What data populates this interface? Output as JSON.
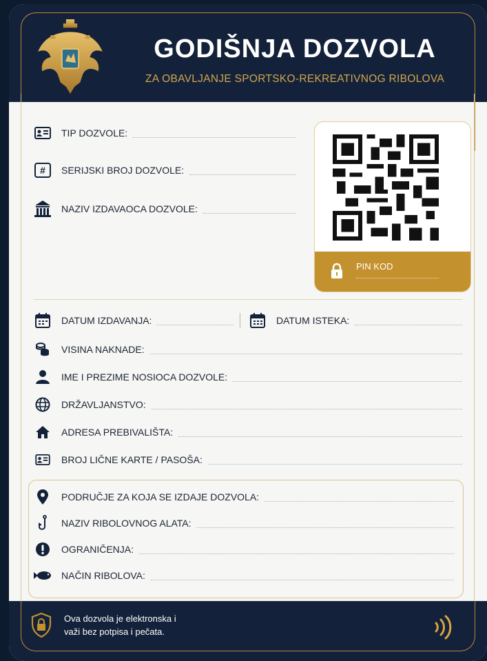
{
  "header": {
    "title": "GODIŠNJA DOZVOLA",
    "subtitle": "ZA OBAVLJANJE SPORTSKO-REKREATIVNOG RIBOLOVA",
    "crest_icon": "montenegro-coat-of-arms"
  },
  "top_fields": [
    {
      "label": "TIP DOZVOLE:",
      "icon": "id-card-icon"
    },
    {
      "label": "SERIJSKI BROJ DOZVOLE:",
      "icon": "hash-icon"
    },
    {
      "label": "NAZIV IZDAVAOCA DOZVOLE:",
      "icon": "building-icon"
    }
  ],
  "qr": {
    "pin_label": "PIN KOD"
  },
  "dates": {
    "issue_label": "DATUM IZDAVANJA:",
    "expiry_label": "DATUM ISTEKA:"
  },
  "person_fields": [
    {
      "label": "VISINA NAKNADE:",
      "icon": "coins-icon"
    },
    {
      "label": "IME I PREZIME NOSIOCA DOZVOLE:",
      "icon": "person-icon"
    },
    {
      "label": "DRŽAVLJANSTVO:",
      "icon": "globe-icon"
    },
    {
      "label": "ADRESA PREBIVALIŠTA:",
      "icon": "home-icon"
    },
    {
      "label": "BROJ LIČNE KARTE / PASOŠA:",
      "icon": "id-card-icon"
    }
  ],
  "fishing_fields": [
    {
      "label": "PODRUČJE ZA KOJA SE IZDAJE DOZVOLA:",
      "icon": "location-pin-icon"
    },
    {
      "label": "NAZIV RIBOLOVNOG ALATA:",
      "icon": "fish-hook-icon"
    },
    {
      "label": "OGRANIČENJA:",
      "icon": "warning-icon"
    },
    {
      "label": "NAČIN RIBOLOVA:",
      "icon": "fish-icon"
    }
  ],
  "footer": {
    "line1": "Ova dozvola je elektronska i",
    "line2": "važi bez potpisa i pečata.",
    "shield_icon": "shield-lock-icon",
    "nfc_icon": "nfc-icon"
  },
  "colors": {
    "navy": "#13223a",
    "gold": "#c4912f",
    "paper": "#f6f6f4"
  }
}
